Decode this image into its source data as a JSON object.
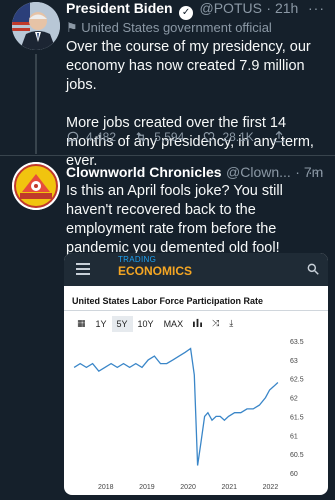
{
  "tweet1": {
    "name": "President Biden",
    "handle": "@POTUS",
    "time": "· 21h",
    "more": "···",
    "label": "United States government official",
    "text_p1": "Over the course of my presidency, our economy has now created 7.9 million jobs.",
    "text_p2": "More jobs created over the first 14 months of any presidency, in any term, ever.",
    "replies": "4,482",
    "retweets": "5,594",
    "likes": "28.1K"
  },
  "tweet2": {
    "name": "Clownworld Chronicles",
    "handle": "@Clown...",
    "time": "· 7m",
    "more": "···",
    "text": "Is this an April fools joke? You still haven't recovered back to the employment rate from before the pandemic you demented old fool!"
  },
  "card": {
    "brand_top": "TRADING",
    "brand": "ECONOMICS",
    "title": "United States Labor Force Participation Rate",
    "ranges": [
      "1Y",
      "5Y",
      "10Y",
      "MAX"
    ],
    "selected_range": "5Y",
    "colors": {
      "line": "#3a86c8",
      "brand": "#f5a623",
      "header": "#1f2b36"
    }
  },
  "chart_data": {
    "type": "line",
    "title": "United States Labor Force Participation Rate",
    "x_ticks": [
      "2018",
      "2019",
      "2020",
      "2021",
      "2022"
    ],
    "y_ticks": [
      63.5,
      63,
      62.5,
      62,
      61.5,
      61,
      60.5,
      60
    ],
    "ylim": [
      60,
      63.5
    ],
    "x": [
      2017.25,
      2017.4,
      2017.55,
      2017.7,
      2017.85,
      2018.0,
      2018.15,
      2018.3,
      2018.45,
      2018.6,
      2018.75,
      2018.9,
      2019.05,
      2019.2,
      2019.35,
      2019.5,
      2019.65,
      2019.8,
      2019.95,
      2020.08,
      2020.17,
      2020.25,
      2020.33,
      2020.42,
      2020.5,
      2020.6,
      2020.7,
      2020.8,
      2020.9,
      2021.0,
      2021.15,
      2021.3,
      2021.45,
      2021.6,
      2021.75,
      2021.9,
      2022.0,
      2022.1,
      2022.2
    ],
    "y": [
      62.8,
      62.9,
      62.8,
      62.9,
      62.7,
      62.8,
      62.9,
      62.8,
      62.9,
      62.8,
      62.9,
      62.8,
      63.0,
      63.1,
      62.9,
      62.9,
      63.0,
      63.1,
      63.2,
      63.3,
      62.6,
      60.2,
      60.8,
      61.5,
      61.6,
      61.4,
      61.5,
      61.5,
      61.4,
      61.5,
      61.6,
      61.6,
      61.7,
      61.7,
      61.8,
      62.0,
      62.2,
      62.3,
      62.4
    ],
    "grid": false
  }
}
